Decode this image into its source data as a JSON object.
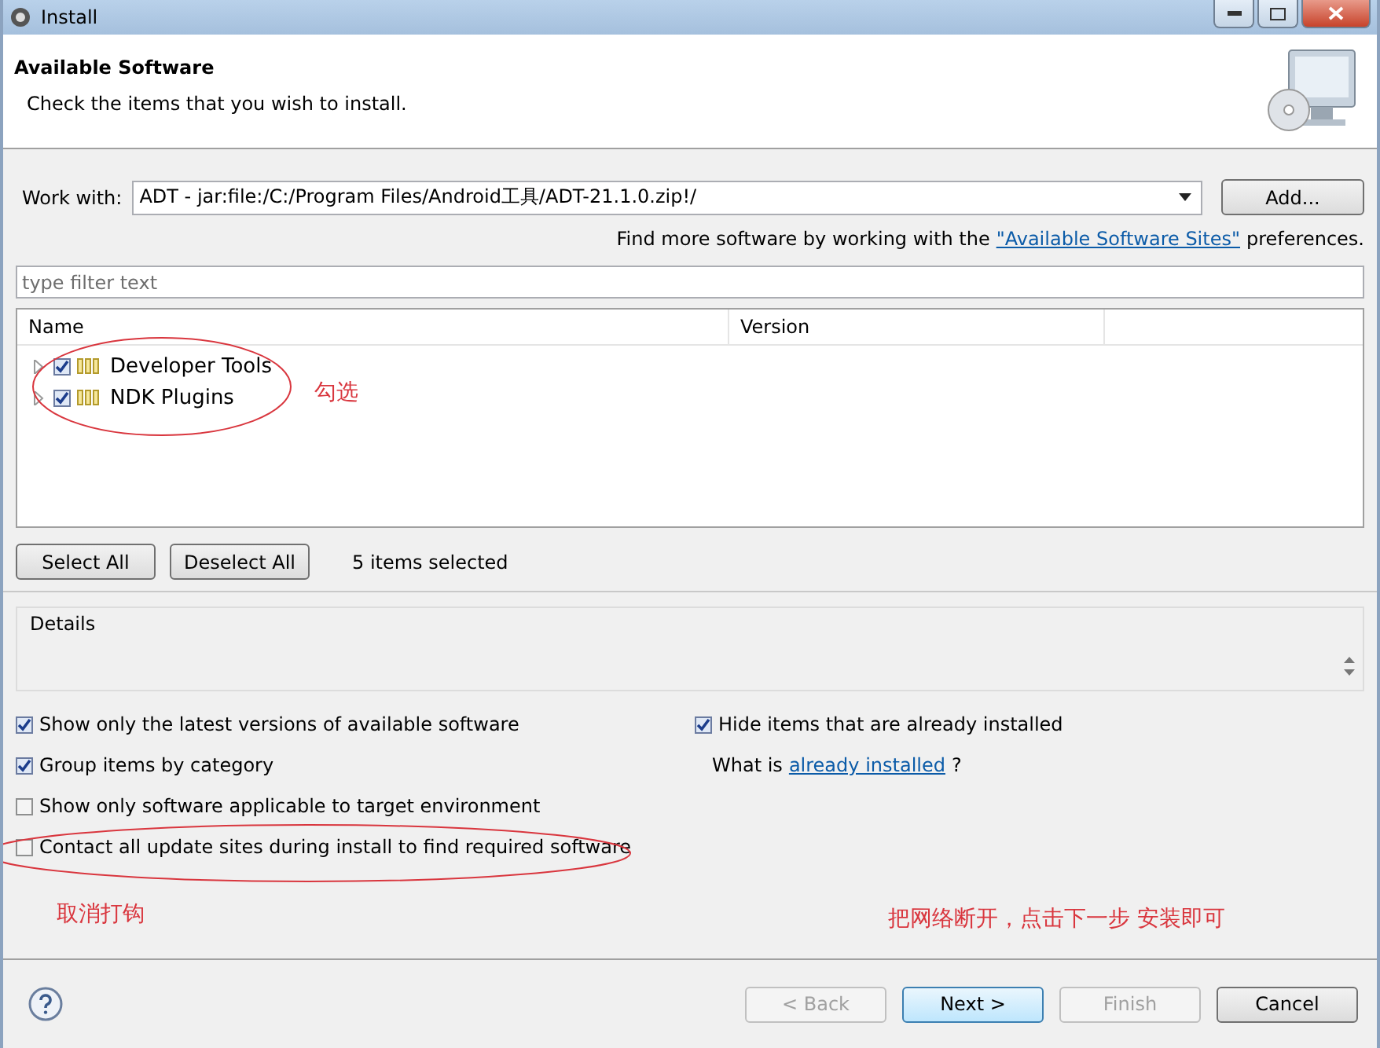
{
  "window": {
    "title": "Install"
  },
  "header": {
    "title": "Available Software",
    "subtitle": "Check the items that you wish to install."
  },
  "work_with": {
    "label": "Work with:",
    "value": "ADT - jar:file:/C:/Program Files/Android工具/ADT-21.1.0.zip!/",
    "button": "Add..."
  },
  "find_more": {
    "before": "Find more software by working with the",
    "link": "\"Available Software Sites\"",
    "after": "preferences."
  },
  "filter": {
    "placeholder": "type filter text"
  },
  "table": {
    "columns": [
      "Name",
      "Version"
    ],
    "rows": [
      {
        "name": "Developer Tools",
        "checked": true,
        "expanded": false
      },
      {
        "name": "NDK Plugins",
        "checked": true,
        "expanded": false
      }
    ]
  },
  "selection": {
    "buttons": [
      "Select All",
      "Deselect All"
    ],
    "status": "5 items selected"
  },
  "details": {
    "label": "Details"
  },
  "options_left": [
    {
      "label": "Show only the latest versions of available software",
      "checked": true
    },
    {
      "label": "Group items by category",
      "checked": true
    },
    {
      "label": "Show only software applicable to target environment",
      "checked": false
    },
    {
      "label": "Contact all update sites during install to find required software",
      "checked": false
    }
  ],
  "options_right": {
    "checkbox": {
      "label": "Hide items that are already installed",
      "checked": true
    },
    "before": "What is",
    "link": "already installed",
    "after": "?"
  },
  "annotations": [
    {
      "text": "勾选"
    },
    {
      "text": "取消打钩"
    },
    {
      "text": "把网络断开，点击下一步 安装即可"
    }
  ],
  "footer": {
    "buttons": [
      {
        "label": "< Back",
        "disabled": true,
        "default": false
      },
      {
        "label": "Next >",
        "disabled": false,
        "default": true
      },
      {
        "label": "Finish",
        "disabled": true,
        "default": false
      },
      {
        "label": "Cancel",
        "disabled": false,
        "default": false
      }
    ]
  }
}
